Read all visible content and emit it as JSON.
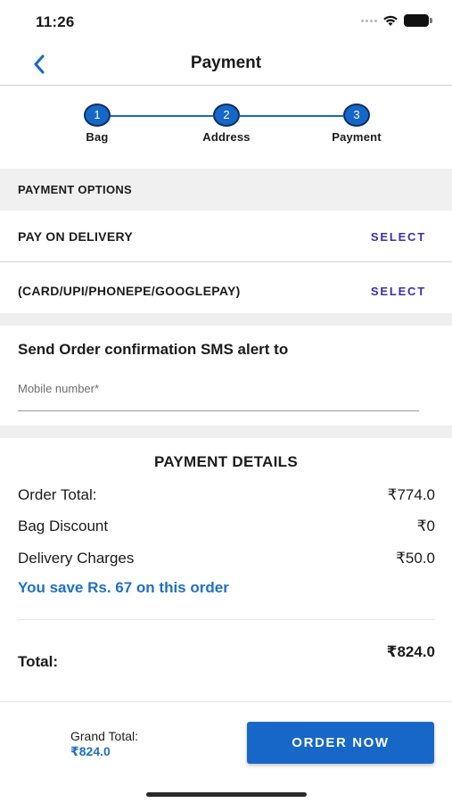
{
  "status_bar": {
    "time": "11:26"
  },
  "nav": {
    "title": "Payment"
  },
  "steps": [
    {
      "number": "1",
      "label": "Bag"
    },
    {
      "number": "2",
      "label": "Address"
    },
    {
      "number": "3",
      "label": "Payment"
    }
  ],
  "payment_options": {
    "header": "PAYMENT OPTIONS",
    "options": [
      {
        "label": "PAY ON DELIVERY",
        "action": "SELECT"
      },
      {
        "label": "(CARD/UPI/PHONEPE/GOOGLEPAY)",
        "action": "SELECT"
      }
    ]
  },
  "sms": {
    "title": "Send Order confirmation SMS alert to",
    "placeholder": "Mobile number*",
    "value": ""
  },
  "payment_details": {
    "title": "PAYMENT DETAILS",
    "rows": [
      {
        "label": "Order Total:",
        "value": "₹774.0"
      },
      {
        "label": "Bag Discount",
        "value": "₹0"
      },
      {
        "label": "Delivery Charges",
        "value": "₹50.0"
      }
    ],
    "savings": "You save Rs. 67 on this order",
    "total_label": "Total:",
    "total_value": "₹824.0"
  },
  "footer": {
    "grand_total_label": "Grand Total:",
    "grand_total_value": "₹824.0",
    "order_button": "ORDER NOW"
  },
  "colors": {
    "accent": "#1767c9",
    "select_text": "#3a2fa8",
    "savings_text": "#1f6fc6",
    "section_bg": "#f0f0f0"
  }
}
